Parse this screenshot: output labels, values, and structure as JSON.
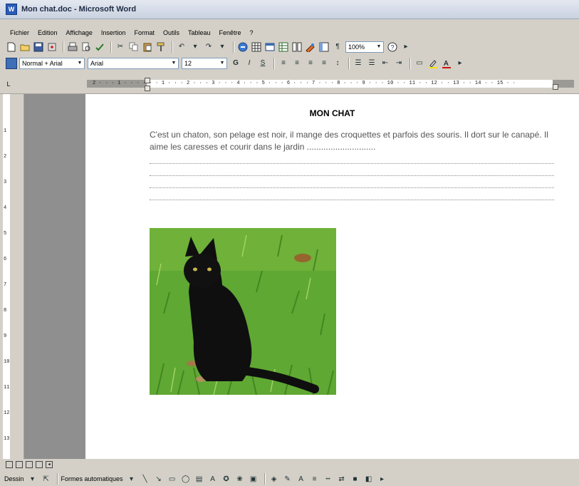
{
  "window": {
    "title": "Mon chat.doc - Microsoft Word",
    "icon": "word-app-icon"
  },
  "menu": [
    "Fichier",
    "Edition",
    "Affichage",
    "Insertion",
    "Format",
    "Outils",
    "Tableau",
    "Fenêtre",
    "?"
  ],
  "toolbar": {
    "zoom": "100%",
    "style": "Normal + Arial",
    "font": "Arial",
    "size": "12",
    "bold_label": "G",
    "italic_label": "I",
    "underline_label": "S",
    "help_label": "?"
  },
  "ruler": {
    "labels": "2 · · · 1 · · ·   · · · 1 · · · 2 · · · 3 · · · 4 · · · 5 · · · 6 · · · 7 · · · 8 · · · 9 · · · 10 · · 11 · · 12 · · 13 · · 14 · · 15 · ·",
    "vertical_labels": [
      "1",
      "2",
      "3",
      "4",
      "5",
      "6",
      "7",
      "8",
      "9",
      "10",
      "11",
      "12",
      "13"
    ]
  },
  "document": {
    "title": "MON CHAT",
    "paragraph": "C'est un chaton, son pelage est noir, il mange des croquettes et parfois des souris. Il dort sur le canapé. Il aime les caresses et courir dans le jardin ............................."
  },
  "drawing_toolbar": {
    "draw_label": "Dessin",
    "autoshapes_label": "Formes automatiques"
  },
  "colors": {
    "background": "#d4d0c8",
    "page": "#ffffff",
    "margin": "#8f8f8f",
    "grass": "#5fa833",
    "cat": "#0f0f0f"
  }
}
